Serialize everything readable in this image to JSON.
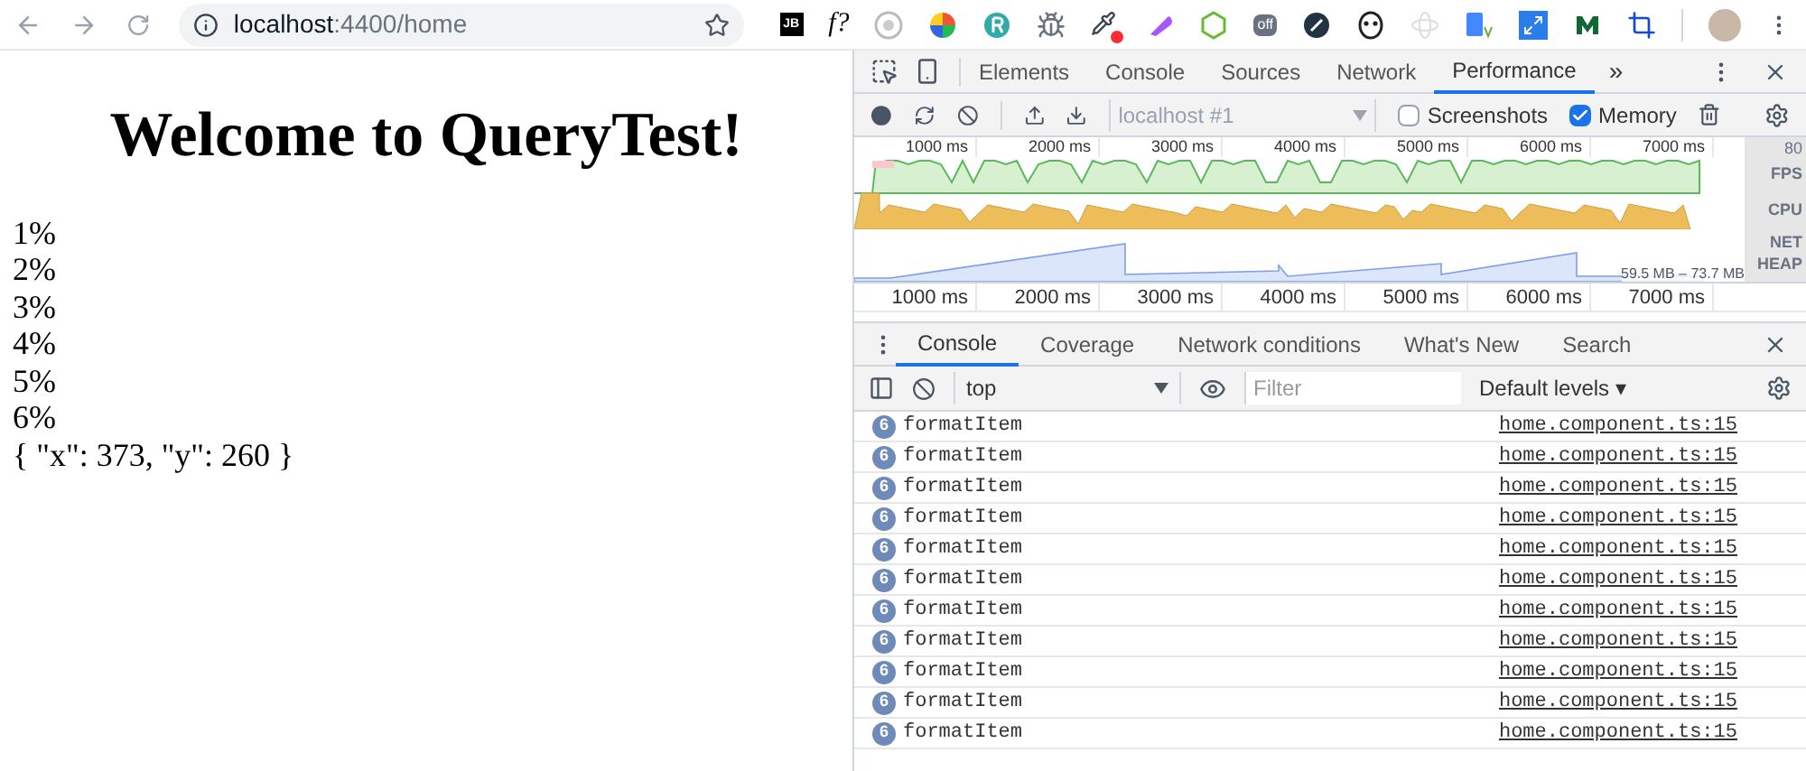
{
  "browser": {
    "url_host": "localhost",
    "url_rest": ":4400/home",
    "extensions": [
      {
        "kind": "jb",
        "text": "JB"
      },
      {
        "kind": "fx",
        "text": "f?"
      },
      {
        "kind": "target"
      },
      {
        "kind": "wheel"
      },
      {
        "kind": "r"
      },
      {
        "kind": "bug"
      },
      {
        "kind": "dropper"
      },
      {
        "kind": "paint"
      },
      {
        "kind": "node"
      },
      {
        "kind": "off",
        "text": "off"
      },
      {
        "kind": "slash"
      },
      {
        "kind": "mask"
      },
      {
        "kind": "react"
      },
      {
        "kind": "translate"
      },
      {
        "kind": "expand"
      },
      {
        "kind": "m"
      },
      {
        "kind": "crop"
      }
    ]
  },
  "page": {
    "heading": "Welcome to QueryTest!",
    "lines": [
      "1%",
      "2%",
      "3%",
      "4%",
      "5%",
      "6%",
      "{ \"x\": 373, \"y\": 260 }"
    ]
  },
  "devtools": {
    "tabs": [
      {
        "label": "Elements",
        "selected": false
      },
      {
        "label": "Console",
        "selected": false
      },
      {
        "label": "Sources",
        "selected": false
      },
      {
        "label": "Network",
        "selected": false
      },
      {
        "label": "Performance",
        "selected": true
      }
    ],
    "more": "»",
    "target": "localhost #1",
    "options": [
      {
        "label": "Screenshots",
        "checked": false
      },
      {
        "label": "Memory",
        "checked": true
      }
    ],
    "ticks": [
      "1000 ms",
      "2000 ms",
      "3000 ms",
      "4000 ms",
      "5000 ms",
      "6000 ms",
      "7000 ms"
    ],
    "ticks_bottom": [
      "1000 ms",
      "2000 ms",
      "3000 ms",
      "4000 ms",
      "5000 ms",
      "6000 ms",
      "7000 ms"
    ],
    "track_labels": [
      "80",
      "FPS",
      "CPU",
      "NET",
      "HEAP"
    ],
    "heap_range": "59.5 MB – 73.7 MB",
    "drawer_tabs": [
      {
        "label": "Console",
        "selected": true
      },
      {
        "label": "Coverage",
        "selected": false
      },
      {
        "label": "Network conditions",
        "selected": false
      },
      {
        "label": "What's New",
        "selected": false
      },
      {
        "label": "Search",
        "selected": false
      }
    ],
    "context": "top",
    "filter_placeholder": "Filter",
    "levels": "Default levels ▾",
    "messages": [
      {
        "count": "6",
        "text": "formatItem",
        "source": "home.component.ts:15"
      },
      {
        "count": "6",
        "text": "formatItem",
        "source": "home.component.ts:15"
      },
      {
        "count": "6",
        "text": "formatItem",
        "source": "home.component.ts:15"
      },
      {
        "count": "6",
        "text": "formatItem",
        "source": "home.component.ts:15"
      },
      {
        "count": "6",
        "text": "formatItem",
        "source": "home.component.ts:15"
      },
      {
        "count": "6",
        "text": "formatItem",
        "source": "home.component.ts:15"
      },
      {
        "count": "6",
        "text": "formatItem",
        "source": "home.component.ts:15"
      },
      {
        "count": "6",
        "text": "formatItem",
        "source": "home.component.ts:15"
      },
      {
        "count": "6",
        "text": "formatItem",
        "source": "home.component.ts:15"
      },
      {
        "count": "6",
        "text": "formatItem",
        "source": "home.component.ts:15"
      },
      {
        "count": "6",
        "text": "formatItem",
        "source": "home.component.ts:15"
      }
    ]
  }
}
